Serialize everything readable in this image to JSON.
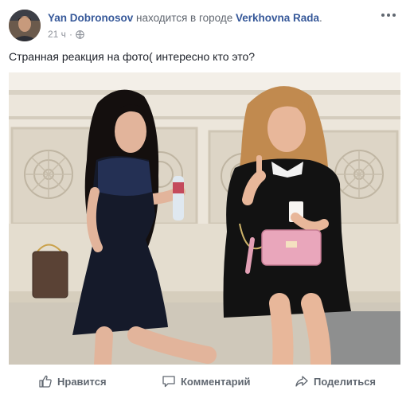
{
  "post": {
    "author": "Yan Dobronosov",
    "location_prefix": " находится в городе ",
    "location": "Verkhovna Rada",
    "location_suffix": ".",
    "timestamp": "21 ч",
    "privacy_sep": " · ",
    "privacy_icon": "globe-icon",
    "text": "Странная реакция на фото( интересно кто это?"
  },
  "actions": {
    "like_label": "Нравится",
    "comment_label": "Комментарий",
    "share_label": "Поделиться"
  },
  "colors": {
    "link": "#365899",
    "muted": "#90949c",
    "action": "#606770"
  }
}
